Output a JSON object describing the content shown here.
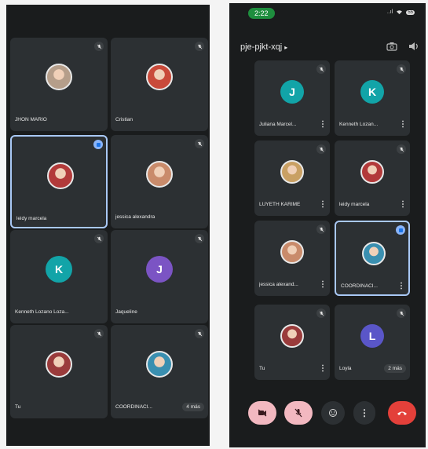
{
  "left": {
    "tiles": [
      {
        "name": "JHON MARIO",
        "avatar_kind": "photo",
        "photo_color": "#b59e8a"
      },
      {
        "name": "Cristian",
        "avatar_kind": "photo",
        "photo_color": "#c94a3a"
      },
      {
        "name": "leidy marcela",
        "avatar_kind": "photo",
        "photo_color": "#b23a3a"
      },
      {
        "name": "jessica alexandra",
        "avatar_kind": "photo",
        "photo_color": "#c98b6b"
      },
      {
        "name": "Kenneth Lozano Loza...",
        "avatar_kind": "letter",
        "letter": "K",
        "color": "#12a4a8"
      },
      {
        "name": "Jaqueline",
        "avatar_kind": "letter",
        "letter": "J",
        "color": "#7b54c4"
      },
      {
        "name": "Tu",
        "avatar_kind": "photo",
        "photo_color": "#9a3b3b"
      },
      {
        "name": "COORDINACI...",
        "avatar_kind": "photo",
        "photo_color": "#3a8fb0",
        "badge": "4 más"
      }
    ]
  },
  "right": {
    "status": {
      "time": "2:22",
      "signal": "..ıl",
      "wifi": "wifi",
      "battery": "55"
    },
    "meeting_code": "pje-pjkt-xqj",
    "icons": {
      "camera": "camera-switch-icon",
      "speaker": "speaker-icon"
    },
    "tiles": [
      {
        "name": "Juliana Marcel...",
        "avatar_kind": "letter",
        "letter": "J",
        "color": "#12a4a8"
      },
      {
        "name": "Kenneth Lozan...",
        "avatar_kind": "letter",
        "letter": "K",
        "color": "#12a4a8"
      },
      {
        "name": "LUYETH KARIME",
        "avatar_kind": "photo",
        "photo_color": "#c9a064"
      },
      {
        "name": "leidy marcela",
        "avatar_kind": "photo",
        "photo_color": "#b23a3a"
      },
      {
        "name": "jessica alexand...",
        "avatar_kind": "photo",
        "photo_color": "#c98b6b"
      },
      {
        "name": "COORDINACI...",
        "avatar_kind": "photo",
        "photo_color": "#3a8fb0"
      },
      {
        "name": "Tu",
        "avatar_kind": "photo",
        "photo_color": "#9a3b3b"
      },
      {
        "name": "Loyla",
        "avatar_kind": "letter",
        "letter": "L",
        "color": "#5a56c8",
        "badge": "2 más"
      }
    ],
    "controls": [
      {
        "name": "camera-off-button",
        "icon": "camera-off-icon",
        "bg": "#f2b8c0"
      },
      {
        "name": "mic-off-button",
        "icon": "mic-off-icon",
        "bg": "#f2b8c0"
      },
      {
        "name": "reactions-button",
        "icon": "emoji-icon",
        "bg": "#2c3033"
      },
      {
        "name": "more-options-button",
        "icon": "more-vert-icon",
        "bg": "#2c3033"
      },
      {
        "name": "leave-call-button",
        "icon": "hangup-icon",
        "bg": "#e3403a"
      }
    ]
  }
}
